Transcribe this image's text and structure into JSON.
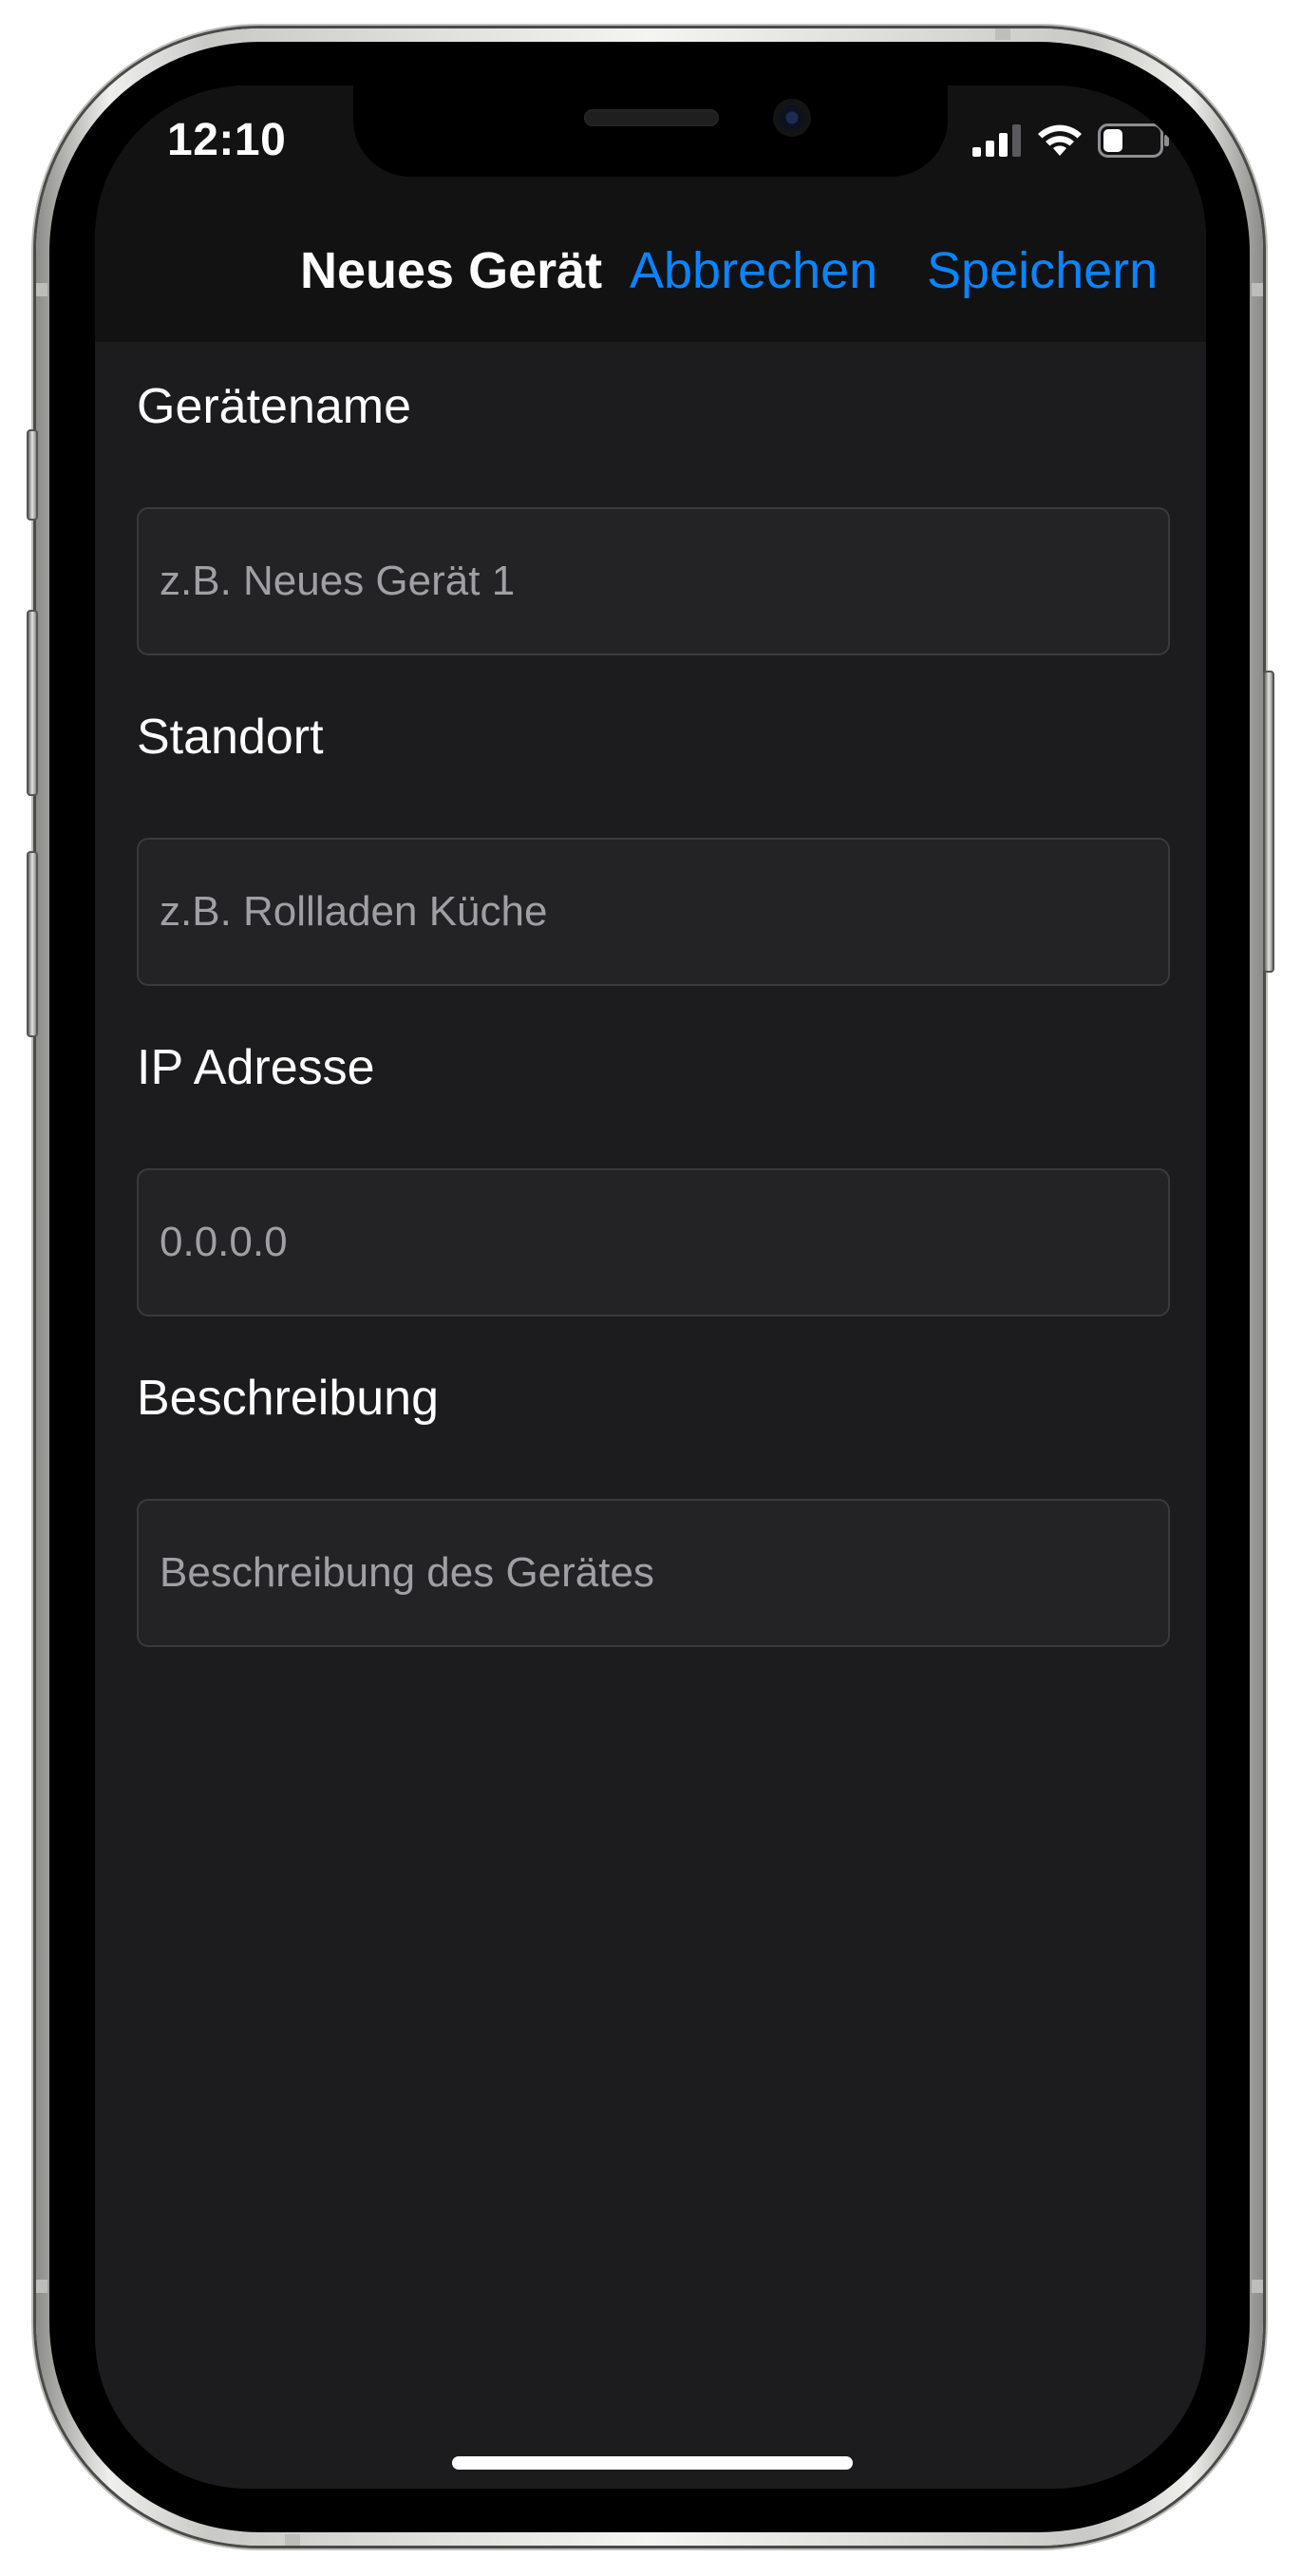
{
  "status_bar": {
    "time": "12:10",
    "icons": [
      "cellular-signal-icon",
      "wifi-icon",
      "battery-icon"
    ]
  },
  "nav_bar": {
    "title": "Neues Gerät",
    "cancel_label": "Abbrechen",
    "save_label": "Speichern"
  },
  "form": {
    "fields": [
      {
        "label": "Gerätename",
        "placeholder": "z.B. Neues Gerät 1",
        "value": ""
      },
      {
        "label": "Standort",
        "placeholder": "z.B. Rollladen Küche",
        "value": ""
      },
      {
        "label": "IP Adresse",
        "placeholder": "0.0.0.0",
        "value": ""
      },
      {
        "label": "Beschreibung",
        "placeholder": "Beschreibung des Gerätes",
        "value": ""
      }
    ]
  },
  "colors": {
    "accent": "#0a84ff",
    "background": "#1c1c1e",
    "nav_background": "#121212",
    "field_background": "#232325",
    "placeholder_text": "#a0a0a4"
  },
  "battery_level": 0.35
}
